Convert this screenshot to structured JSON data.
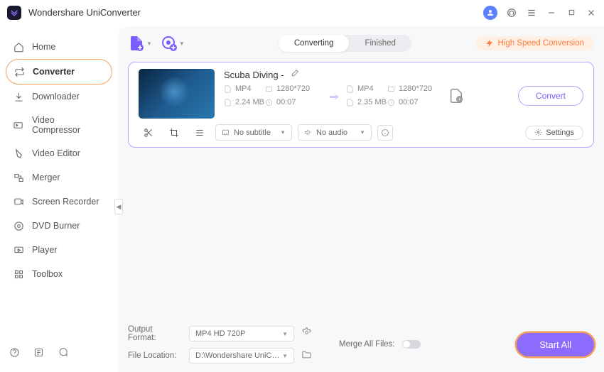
{
  "app": {
    "title": "Wondershare UniConverter"
  },
  "sidebar": {
    "items": [
      {
        "label": "Home"
      },
      {
        "label": "Converter"
      },
      {
        "label": "Downloader"
      },
      {
        "label": "Video Compressor"
      },
      {
        "label": "Video Editor"
      },
      {
        "label": "Merger"
      },
      {
        "label": "Screen Recorder"
      },
      {
        "label": "DVD Burner"
      },
      {
        "label": "Player"
      },
      {
        "label": "Toolbox"
      }
    ]
  },
  "toolbar": {
    "tabs": {
      "converting": "Converting",
      "finished": "Finished"
    },
    "high_speed": "High Speed Conversion"
  },
  "file": {
    "title": "Scuba Diving -",
    "src": {
      "format": "MP4",
      "resolution": "1280*720",
      "size": "2.24 MB",
      "duration": "00:07"
    },
    "dst": {
      "format": "MP4",
      "resolution": "1280*720",
      "size": "2.35 MB",
      "duration": "00:07"
    },
    "subtitle": "No subtitle",
    "audio": "No audio",
    "settings": "Settings",
    "convert": "Convert"
  },
  "footer": {
    "output_format_label": "Output Format:",
    "output_format": "MP4 HD 720P",
    "file_location_label": "File Location:",
    "file_location": "D:\\Wondershare UniConverter",
    "merge_label": "Merge All Files:",
    "start_all": "Start All"
  }
}
